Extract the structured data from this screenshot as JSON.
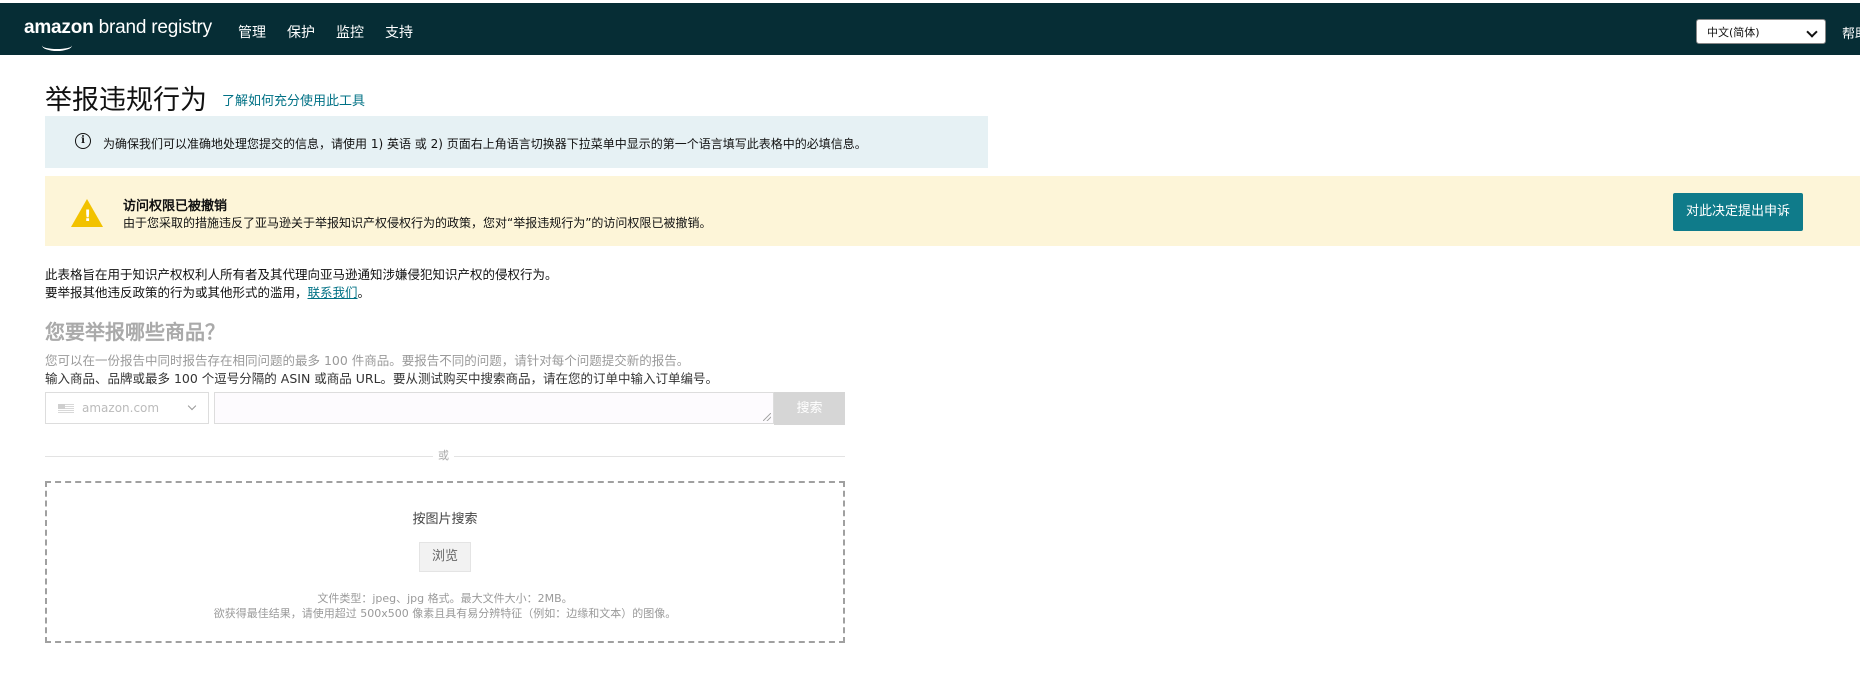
{
  "header": {
    "logo_text_bold": "amazon",
    "logo_text_rest": " brand registry",
    "nav": [
      "管理",
      "保护",
      "监控",
      "支持"
    ],
    "language_selected": "中文(简体)",
    "help_label": "帮助"
  },
  "page": {
    "title": "举报违规行为",
    "learn_link": "了解如何充分使用此工具"
  },
  "info_banner": {
    "text": "为确保我们可以准确地处理您提交的信息，请使用 1) 英语 或 2) 页面右上角语言切换器下拉菜单中显示的第一个语言填写此表格中的必填信息。"
  },
  "warning_banner": {
    "title": "访问权限已被撤销",
    "text": "由于您采取的措施违反了亚马逊关于举报知识产权侵权行为的政策，您对“举报违规行为”的访问权限已被撤销。",
    "appeal_button": "对此决定提出申诉"
  },
  "description": {
    "line1": "此表格旨在用于知识产权权利人所有者及其代理向亚马逊通知涉嫌侵犯知识产权的侵权行为。",
    "line2_prefix": "要举报其他违反政策的行为或其他形式的滥用，",
    "contact_link": "联系我们",
    "line2_suffix": "。"
  },
  "product_search": {
    "title": "您要举报哪些商品？",
    "hint1": "您可以在一份报告中同时报告存在相同问题的最多 100 件商品。要报告不同的问题，请针对每个问题提交新的报告。",
    "hint2": "输入商品、品牌或最多 100 个逗号分隔的 ASIN 或商品 URL。要从测试购买中搜索商品，请在您的订单中输入订单编号。",
    "marketplace": "amazon.com",
    "search_value": "",
    "search_button": "搜索",
    "or_label": "或"
  },
  "image_search": {
    "title": "按图片搜索",
    "browse_button": "浏览",
    "note1": "文件类型：jpeg、jpg 格式。最大文件大小：2MB。",
    "note2": "欲获得最佳结果，请使用超过 500x500 像素且具有易分辨特征（例如：边缘和文本）的图像。"
  },
  "colors": {
    "topbar": "#062d35",
    "accent": "#0f7b8a",
    "link": "#007185",
    "info_bg": "#e6f1f4",
    "warning_bg": "#fdf5d8",
    "warning_icon": "#f2c200"
  },
  "icons": {
    "info": "info-icon",
    "warning": "warning-icon",
    "flag": "us-flag-icon",
    "caret": "chevron-down-icon"
  }
}
